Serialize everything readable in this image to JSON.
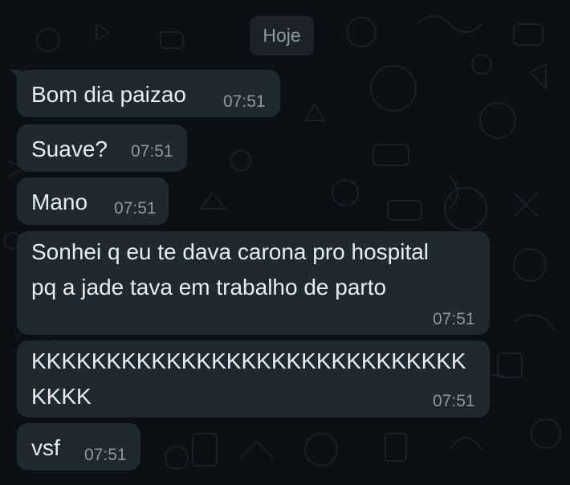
{
  "chat": {
    "date_label": "Hoje",
    "messages": [
      {
        "text": "Bom dia paizao",
        "time": "07:51"
      },
      {
        "text": "Suave?",
        "time": "07:51"
      },
      {
        "text": "Mano",
        "time": "07:51"
      },
      {
        "text_line1": "Sonhei q eu te dava carona pro hospital",
        "text_line2": "pq a jade tava em trabalho de parto",
        "time": "07:51"
      },
      {
        "text_line1": "KKKKKKKKKKKKKKKKKKKKKKKKKKKKK",
        "text_line2": "KKKK",
        "time": "07:51"
      },
      {
        "text": "vsf",
        "time": "07:51"
      }
    ]
  },
  "theme": {
    "background": "#0b1014",
    "bubble_incoming": "#1e2a30",
    "text_primary": "#e9edef",
    "text_secondary": "#8d989f"
  }
}
